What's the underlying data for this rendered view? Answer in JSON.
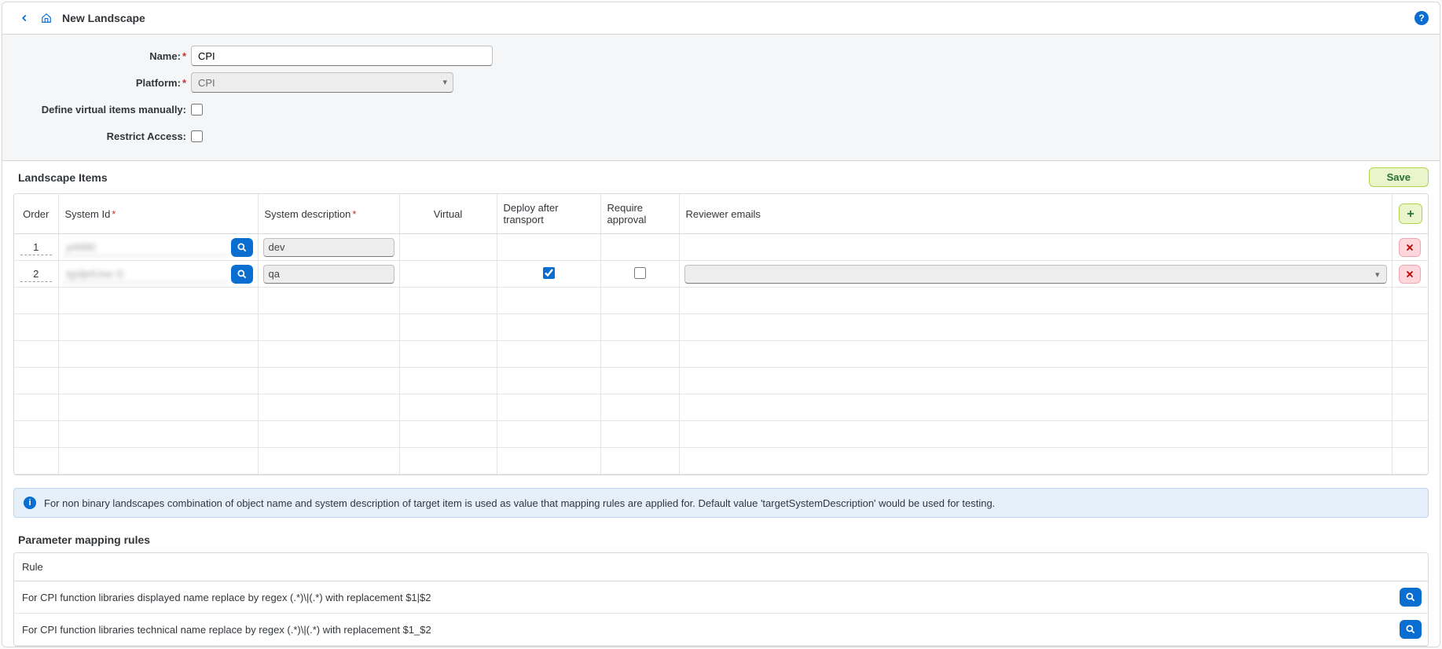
{
  "header": {
    "title": "New Landscape"
  },
  "form": {
    "name_label": "Name:",
    "name_value": "CPI",
    "platform_label": "Platform:",
    "platform_value": "CPI",
    "define_label": "Define virtual items manually:",
    "restrict_label": "Restrict Access:"
  },
  "landscape": {
    "section_title": "Landscape Items",
    "save_label": "Save",
    "columns": {
      "order": "Order",
      "system_id": "System Id",
      "system_desc": "System description",
      "virtual": "Virtual",
      "deploy": "Deploy after transport",
      "approve": "Require approval",
      "reviewer": "Reviewer emails"
    },
    "rows": [
      {
        "order": "1",
        "system_id": "p4990",
        "system_desc": "dev",
        "has_deploy": false,
        "has_approve": false,
        "has_reviewer": false
      },
      {
        "order": "2",
        "system_id": "tgsljeIUoe G",
        "system_desc": "qa",
        "has_deploy": true,
        "deploy": true,
        "has_approve": true,
        "approve": false,
        "has_reviewer": true
      }
    ]
  },
  "info": {
    "text": "For non binary landscapes combination of object name and system description of target item is used as value that mapping rules are applied for. Default value 'targetSystemDescription' would be used for testing."
  },
  "rules": {
    "section_title": "Parameter mapping rules",
    "column": "Rule",
    "items": [
      "For CPI function libraries displayed name replace by regex (.*)\\|(.*) with replacement $1|$2",
      "For CPI function libraries technical name replace by regex (.*)\\|(.*) with replacement $1_$2"
    ]
  }
}
